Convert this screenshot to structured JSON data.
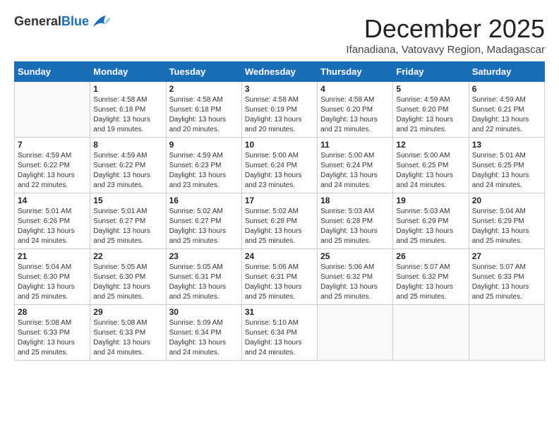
{
  "header": {
    "logo_general": "General",
    "logo_blue": "Blue",
    "month_title": "December 2025",
    "location": "Ifanadiana, Vatovavy Region, Madagascar"
  },
  "weekdays": [
    "Sunday",
    "Monday",
    "Tuesday",
    "Wednesday",
    "Thursday",
    "Friday",
    "Saturday"
  ],
  "weeks": [
    [
      {
        "day": "",
        "sunrise": "",
        "sunset": "",
        "daylight": ""
      },
      {
        "day": "1",
        "sunrise": "Sunrise: 4:58 AM",
        "sunset": "Sunset: 6:18 PM",
        "daylight": "Daylight: 13 hours and 19 minutes."
      },
      {
        "day": "2",
        "sunrise": "Sunrise: 4:58 AM",
        "sunset": "Sunset: 6:18 PM",
        "daylight": "Daylight: 13 hours and 20 minutes."
      },
      {
        "day": "3",
        "sunrise": "Sunrise: 4:58 AM",
        "sunset": "Sunset: 6:19 PM",
        "daylight": "Daylight: 13 hours and 20 minutes."
      },
      {
        "day": "4",
        "sunrise": "Sunrise: 4:58 AM",
        "sunset": "Sunset: 6:20 PM",
        "daylight": "Daylight: 13 hours and 21 minutes."
      },
      {
        "day": "5",
        "sunrise": "Sunrise: 4:59 AM",
        "sunset": "Sunset: 6:20 PM",
        "daylight": "Daylight: 13 hours and 21 minutes."
      },
      {
        "day": "6",
        "sunrise": "Sunrise: 4:59 AM",
        "sunset": "Sunset: 6:21 PM",
        "daylight": "Daylight: 13 hours and 22 minutes."
      }
    ],
    [
      {
        "day": "7",
        "sunrise": "Sunrise: 4:59 AM",
        "sunset": "Sunset: 6:22 PM",
        "daylight": "Daylight: 13 hours and 22 minutes."
      },
      {
        "day": "8",
        "sunrise": "Sunrise: 4:59 AM",
        "sunset": "Sunset: 6:22 PM",
        "daylight": "Daylight: 13 hours and 23 minutes."
      },
      {
        "day": "9",
        "sunrise": "Sunrise: 4:59 AM",
        "sunset": "Sunset: 6:23 PM",
        "daylight": "Daylight: 13 hours and 23 minutes."
      },
      {
        "day": "10",
        "sunrise": "Sunrise: 5:00 AM",
        "sunset": "Sunset: 6:24 PM",
        "daylight": "Daylight: 13 hours and 23 minutes."
      },
      {
        "day": "11",
        "sunrise": "Sunrise: 5:00 AM",
        "sunset": "Sunset: 6:24 PM",
        "daylight": "Daylight: 13 hours and 24 minutes."
      },
      {
        "day": "12",
        "sunrise": "Sunrise: 5:00 AM",
        "sunset": "Sunset: 6:25 PM",
        "daylight": "Daylight: 13 hours and 24 minutes."
      },
      {
        "day": "13",
        "sunrise": "Sunrise: 5:01 AM",
        "sunset": "Sunset: 6:25 PM",
        "daylight": "Daylight: 13 hours and 24 minutes."
      }
    ],
    [
      {
        "day": "14",
        "sunrise": "Sunrise: 5:01 AM",
        "sunset": "Sunset: 6:26 PM",
        "daylight": "Daylight: 13 hours and 24 minutes."
      },
      {
        "day": "15",
        "sunrise": "Sunrise: 5:01 AM",
        "sunset": "Sunset: 6:27 PM",
        "daylight": "Daylight: 13 hours and 25 minutes."
      },
      {
        "day": "16",
        "sunrise": "Sunrise: 5:02 AM",
        "sunset": "Sunset: 6:27 PM",
        "daylight": "Daylight: 13 hours and 25 minutes."
      },
      {
        "day": "17",
        "sunrise": "Sunrise: 5:02 AM",
        "sunset": "Sunset: 6:28 PM",
        "daylight": "Daylight: 13 hours and 25 minutes."
      },
      {
        "day": "18",
        "sunrise": "Sunrise: 5:03 AM",
        "sunset": "Sunset: 6:28 PM",
        "daylight": "Daylight: 13 hours and 25 minutes."
      },
      {
        "day": "19",
        "sunrise": "Sunrise: 5:03 AM",
        "sunset": "Sunset: 6:29 PM",
        "daylight": "Daylight: 13 hours and 25 minutes."
      },
      {
        "day": "20",
        "sunrise": "Sunrise: 5:04 AM",
        "sunset": "Sunset: 6:29 PM",
        "daylight": "Daylight: 13 hours and 25 minutes."
      }
    ],
    [
      {
        "day": "21",
        "sunrise": "Sunrise: 5:04 AM",
        "sunset": "Sunset: 6:30 PM",
        "daylight": "Daylight: 13 hours and 25 minutes."
      },
      {
        "day": "22",
        "sunrise": "Sunrise: 5:05 AM",
        "sunset": "Sunset: 6:30 PM",
        "daylight": "Daylight: 13 hours and 25 minutes."
      },
      {
        "day": "23",
        "sunrise": "Sunrise: 5:05 AM",
        "sunset": "Sunset: 6:31 PM",
        "daylight": "Daylight: 13 hours and 25 minutes."
      },
      {
        "day": "24",
        "sunrise": "Sunrise: 5:06 AM",
        "sunset": "Sunset: 6:31 PM",
        "daylight": "Daylight: 13 hours and 25 minutes."
      },
      {
        "day": "25",
        "sunrise": "Sunrise: 5:06 AM",
        "sunset": "Sunset: 6:32 PM",
        "daylight": "Daylight: 13 hours and 25 minutes."
      },
      {
        "day": "26",
        "sunrise": "Sunrise: 5:07 AM",
        "sunset": "Sunset: 6:32 PM",
        "daylight": "Daylight: 13 hours and 25 minutes."
      },
      {
        "day": "27",
        "sunrise": "Sunrise: 5:07 AM",
        "sunset": "Sunset: 6:33 PM",
        "daylight": "Daylight: 13 hours and 25 minutes."
      }
    ],
    [
      {
        "day": "28",
        "sunrise": "Sunrise: 5:08 AM",
        "sunset": "Sunset: 6:33 PM",
        "daylight": "Daylight: 13 hours and 25 minutes."
      },
      {
        "day": "29",
        "sunrise": "Sunrise: 5:08 AM",
        "sunset": "Sunset: 6:33 PM",
        "daylight": "Daylight: 13 hours and 24 minutes."
      },
      {
        "day": "30",
        "sunrise": "Sunrise: 5:09 AM",
        "sunset": "Sunset: 6:34 PM",
        "daylight": "Daylight: 13 hours and 24 minutes."
      },
      {
        "day": "31",
        "sunrise": "Sunrise: 5:10 AM",
        "sunset": "Sunset: 6:34 PM",
        "daylight": "Daylight: 13 hours and 24 minutes."
      },
      {
        "day": "",
        "sunrise": "",
        "sunset": "",
        "daylight": ""
      },
      {
        "day": "",
        "sunrise": "",
        "sunset": "",
        "daylight": ""
      },
      {
        "day": "",
        "sunrise": "",
        "sunset": "",
        "daylight": ""
      }
    ]
  ]
}
